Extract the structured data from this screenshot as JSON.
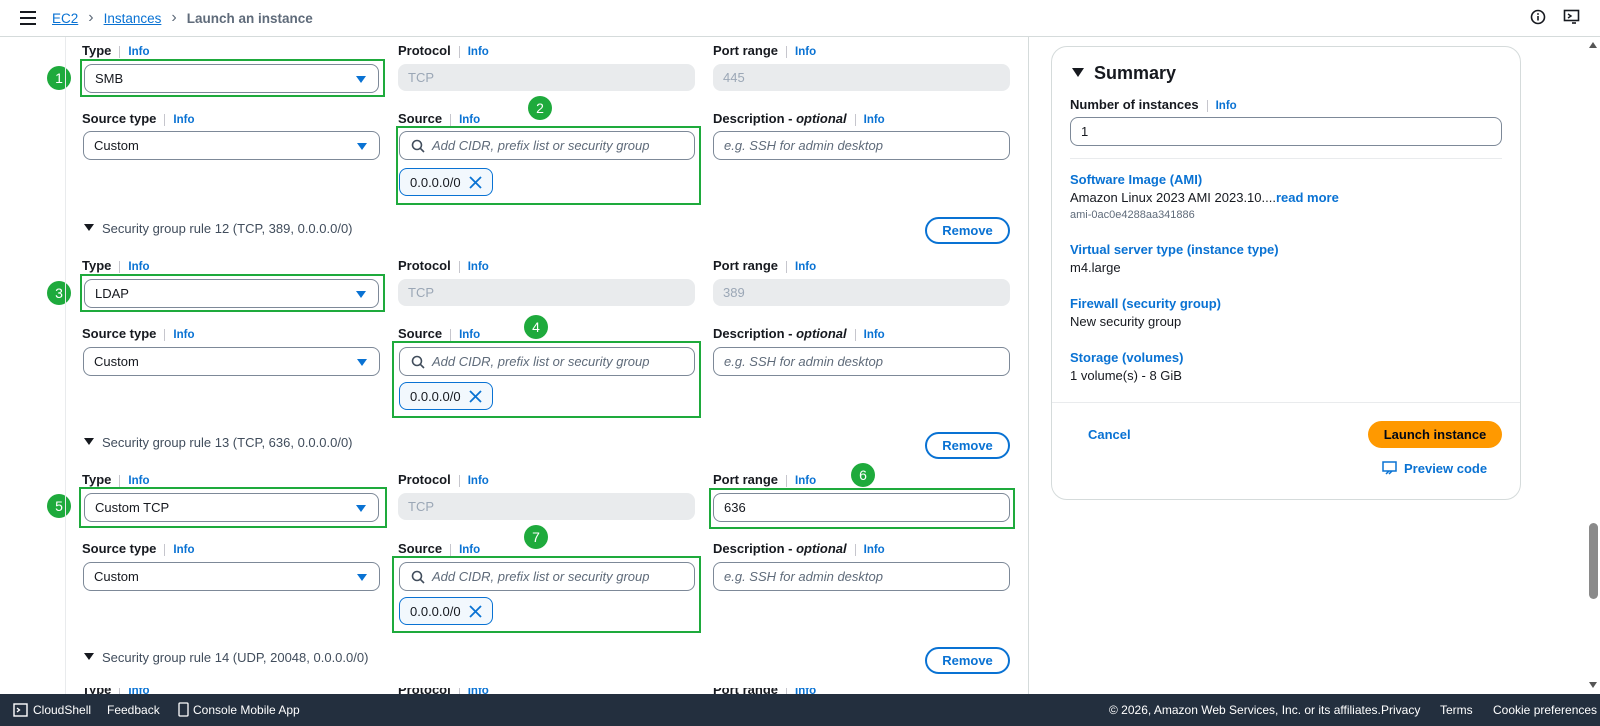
{
  "breadcrumb": {
    "ec2": "EC2",
    "instances": "Instances",
    "current": "Launch an instance"
  },
  "labels": {
    "type": "Type",
    "info": "Info",
    "protocol": "Protocol",
    "port_range": "Port range",
    "source_type": "Source type",
    "source": "Source",
    "description": "Description - ",
    "optional": "optional"
  },
  "rules": [
    {
      "type": "SMB",
      "protocol": "TCP",
      "port": "445",
      "source_type": "Custom",
      "source_placeholder": "Add CIDR, prefix list or security group",
      "token": "0.0.0.0/0",
      "desc_placeholder": "e.g. SSH for admin desktop"
    },
    {
      "header": "Security group rule 12 (TCP, 389, 0.0.0.0/0)",
      "type": "LDAP",
      "protocol": "TCP",
      "port": "389",
      "source_type": "Custom",
      "source_placeholder": "Add CIDR, prefix list or security group",
      "token": "0.0.0.0/0",
      "desc_placeholder": "e.g. SSH for admin desktop"
    },
    {
      "header": "Security group rule 13 (TCP, 636, 0.0.0.0/0)",
      "type": "Custom TCP",
      "protocol": "TCP",
      "port": "636",
      "source_type": "Custom",
      "source_placeholder": "Add CIDR, prefix list or security group",
      "token": "0.0.0.0/0",
      "desc_placeholder": "e.g. SSH for admin desktop"
    },
    {
      "header": "Security group rule 14 (UDP, 20048, 0.0.0.0/0)"
    }
  ],
  "remove_label": "Remove",
  "markers": [
    "1",
    "2",
    "3",
    "4",
    "5",
    "6",
    "7"
  ],
  "summary": {
    "title": "Summary",
    "num_instances_label": "Number of instances",
    "num_instances_value": "1",
    "ami_label": "Software Image (AMI)",
    "ami_value": "Amazon Linux 2023 AMI 2023.10....",
    "ami_read_more": "read more",
    "ami_id": "ami-0ac0e4288aa341886",
    "instance_type_label": "Virtual server type (instance type)",
    "instance_type_value": "m4.large",
    "firewall_label": "Firewall (security group)",
    "firewall_value": "New security group",
    "storage_label": "Storage (volumes)",
    "storage_value": "1 volume(s) - 8 GiB",
    "cancel": "Cancel",
    "launch": "Launch instance",
    "preview": "Preview code"
  },
  "footer": {
    "cloudshell": "CloudShell",
    "feedback": "Feedback",
    "mobile": "Console Mobile App",
    "copyright": "© 2026, Amazon Web Services, Inc. or its affiliates.",
    "privacy": "Privacy",
    "terms": "Terms",
    "cookies": "Cookie preferences"
  },
  "colors": {
    "accent": "#0972d3",
    "annotation": "#1eaa3c",
    "launch": "#ff9900",
    "footer": "#232f3e"
  }
}
